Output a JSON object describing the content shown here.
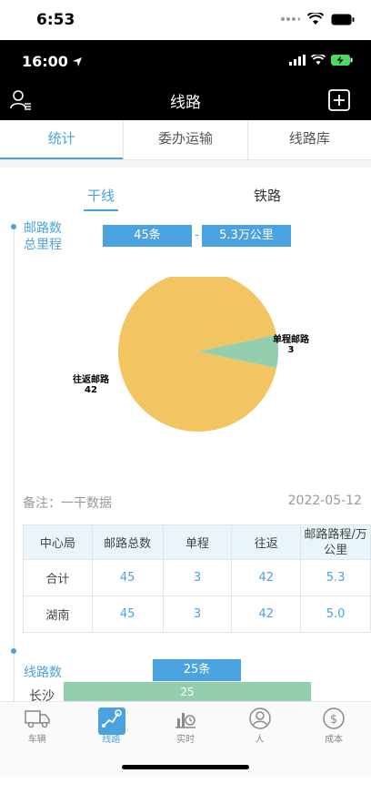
{
  "outer_status": {
    "time": "6:53"
  },
  "inner_status": {
    "time": "16:00"
  },
  "navbar": {
    "title": "线路",
    "left_icon": "user-list-icon",
    "right_icon": "plus-square-icon"
  },
  "tabs": [
    {
      "label": "统计",
      "active": true
    },
    {
      "label": "委办运输",
      "active": false
    },
    {
      "label": "线路库",
      "active": false
    }
  ],
  "subtabs": [
    {
      "label": "干线",
      "active": true
    },
    {
      "label": "铁路",
      "active": false
    }
  ],
  "section1": {
    "label_line1": "邮路数",
    "label_line2": "总里程",
    "route_count": "45条",
    "separator": "-",
    "total_distance": "5.3万公里"
  },
  "pie": {
    "labels": {
      "single_name": "单程邮路",
      "single_value": "3",
      "round_name": "往返邮路",
      "round_value": "42"
    },
    "colors": {
      "single": "#93cfae",
      "round": "#f2c462"
    }
  },
  "note": {
    "text": "备注：一干数据",
    "date": "2022-05-12"
  },
  "table": {
    "headers": [
      "中心局",
      "邮路总数",
      "单程",
      "往返",
      "邮路路程/万公里"
    ],
    "rows": [
      [
        "合计",
        "45",
        "3",
        "42",
        "5.3"
      ],
      [
        "湖南",
        "45",
        "3",
        "42",
        "5.0"
      ]
    ]
  },
  "section2": {
    "label": "线路数",
    "count": "25条",
    "bars": [
      {
        "label": "长沙",
        "value": 25
      }
    ]
  },
  "tabbar": [
    {
      "label": "车辆",
      "icon": "truck-icon",
      "active": false
    },
    {
      "label": "线路",
      "icon": "route-map-icon",
      "active": true
    },
    {
      "label": "实时",
      "icon": "chart-clock-icon",
      "active": false
    },
    {
      "label": "人",
      "icon": "person-icon",
      "active": false
    },
    {
      "label": "成本",
      "icon": "dollar-icon",
      "active": false
    }
  ],
  "chart_data": [
    {
      "type": "pie",
      "categories": [
        "单程邮路",
        "往返邮路"
      ],
      "values": [
        3,
        42
      ],
      "colors": [
        "#93cfae",
        "#f2c462"
      ]
    },
    {
      "type": "bar",
      "categories": [
        "长沙"
      ],
      "values": [
        25
      ],
      "orientation": "horizontal"
    }
  ]
}
